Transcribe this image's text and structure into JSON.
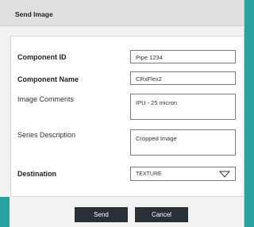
{
  "dialog": {
    "title": "Send Image"
  },
  "form": {
    "component_id": {
      "label": "Component ID",
      "value": "Pipe 1234"
    },
    "component_name": {
      "label": "Component Name",
      "value": "CRxFlex2"
    },
    "image_comments": {
      "label": "Image Comments",
      "value": "IPU - 25 micron"
    },
    "series_description": {
      "label": "Series Description",
      "value": "Cropped Image"
    },
    "destination": {
      "label": "Destination",
      "value": "TEXTURE",
      "icon": "chevron-down-icon"
    }
  },
  "buttons": {
    "send": "Send",
    "cancel": "Cancel"
  }
}
